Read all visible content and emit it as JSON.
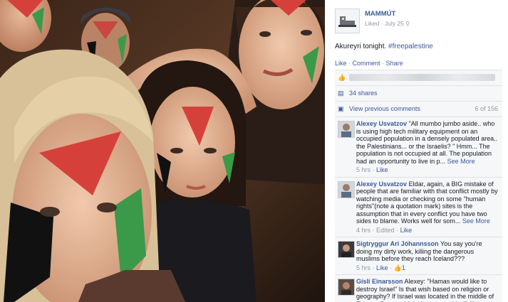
{
  "post": {
    "page_name": "MAMMÚT",
    "status": "Liked",
    "date": "July 25",
    "caption_text": "Akureyri tonight. ",
    "hashtag": "#freepalestine",
    "actions": {
      "like": "Like",
      "comment": "Comment",
      "share": "Share",
      "separator": "·"
    }
  },
  "ufi": {
    "shares": "34 shares",
    "view_previous": "View previous comments",
    "comment_count": "6 of 156"
  },
  "comments": [
    {
      "author": "Alexey Usvatzov",
      "text": "\"All mumbo jumbo aside.. who is using high tech military equipment on an occupied population in a densely populated area.. the Palestinians... or the Israelis? \" Hmm... The population is not occupied at all. The population had an opportunity to live in p...",
      "see_more": "See More",
      "time": "5 hrs",
      "like": "Like"
    },
    {
      "author": "Alexey Usvatzov",
      "text": "Eldar, again, a BIG mistake of people that are familiar with that conflict mostly by watching media or checking on some \"human rights\"(note a quotation mark) sites is the assumption that in every conflict you have two sides to blame. Works well for som...",
      "see_more": "See More",
      "time": "4 hrs",
      "edited": "Edited",
      "like": "Like"
    },
    {
      "author": "Sigtryggur Ari Jóhannsson",
      "text": "You say you're doing my dirty work, killing the dangerous muslims before they reach Iceland???",
      "time": "5 hrs",
      "like": "Like",
      "likes": "1"
    },
    {
      "author": "Gísli Einarsson",
      "text": "Alexey: \"Hamas would like to destroy Israel\" Is that wish based on religion or geography? If Israel was located in the middle of Europe. Do you think Hamas would still like to"
    }
  ],
  "colors": {
    "fb_blue": "#3b5998",
    "meta_gray": "#9197a3",
    "panel_bg": "#f6f7f9",
    "paint_red": "#d5413a",
    "paint_green": "#3a9a4a",
    "paint_black": "#111111"
  }
}
